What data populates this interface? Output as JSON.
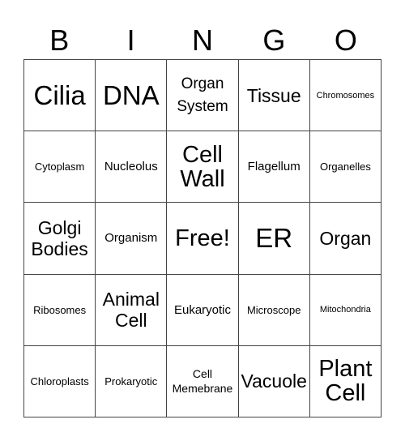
{
  "header": [
    "B",
    "I",
    "N",
    "G",
    "O"
  ],
  "cells": [
    "Cilia",
    "DNA",
    "Organ System",
    "Tissue",
    "Chromosomes",
    "Cytoplasm",
    "Nucleolus",
    "Cell Wall",
    "Flagellum",
    "Organelles",
    "Golgi Bodies",
    "Organism",
    "Free!",
    "ER",
    "Organ",
    "Ribosomes",
    "Animal Cell",
    "Eukaryotic",
    "Microscope",
    "Mitochondria",
    "Chloroplasts",
    "Prokaryotic",
    "Cell Memebrane",
    "Vacuole",
    "Plant Cell"
  ]
}
